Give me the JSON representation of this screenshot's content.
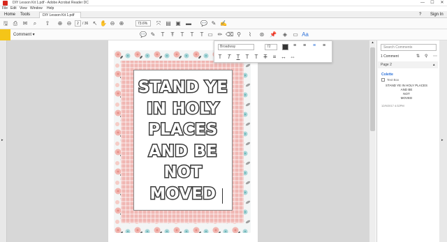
{
  "window": {
    "title": "DIY Lesson Kit 1.pdf - Adobe Acrobat Reader DC",
    "minimize": "—",
    "maximize": "☐",
    "close": "✕"
  },
  "menu": [
    "File",
    "Edit",
    "View",
    "Window",
    "Help"
  ],
  "tabs": {
    "home": "Home",
    "tools": "Tools",
    "document": "DIY Lesson Kit 1.pdf",
    "document_close": "×",
    "help": "?",
    "sign_in": "Sign In"
  },
  "toolbar": {
    "page_current": "2",
    "page_total": "/ 36",
    "zoom": "73.6%"
  },
  "comment": {
    "label": "Comment ▾"
  },
  "format": {
    "font": "Broadway",
    "size": "72",
    "color": "#333333"
  },
  "poster": {
    "lines": [
      "STAND YE",
      "IN HOLY",
      "PLACES",
      "AND BE",
      "NOT",
      "MOVED"
    ]
  },
  "panel": {
    "search_placeholder": "Search Comments",
    "count": "1 Comment",
    "page_label": "Page 2",
    "author": "Colette",
    "type": "Text Box",
    "text_lines": [
      "STAND YE IN HOLY PLACES",
      "AND BE",
      "NOT",
      "MOVED"
    ],
    "time": "12/9/2017 4:32PM"
  },
  "colors": {
    "accent": "#f5c518",
    "frame_pink": "#f0b7b3",
    "author_blue": "#2d72d9",
    "pdf_red": "#d7281d"
  }
}
